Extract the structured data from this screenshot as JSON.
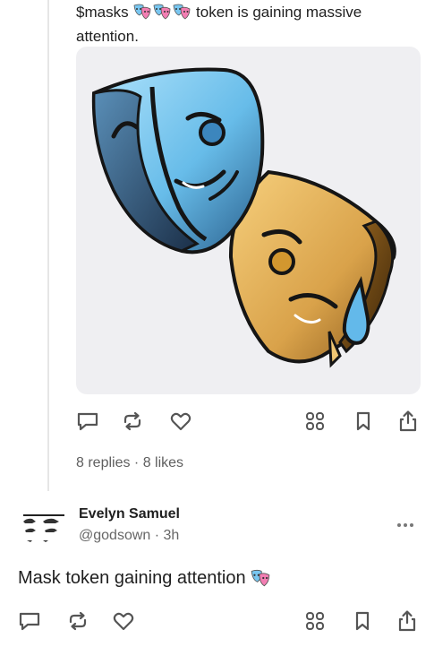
{
  "post": {
    "text_start": "$masks",
    "text_end": " token is gaining massive attention.",
    "emoji": [
      "performing-arts",
      "performing-arts",
      "performing-arts"
    ],
    "image_alt": "comedy and tragedy theater masks"
  },
  "actions": [
    "reply-icon",
    "repost-icon",
    "like-icon",
    "grid-icon",
    "bookmark-icon",
    "share-icon"
  ],
  "stats": {
    "replies": "8 replies",
    "separator": " · ",
    "likes": "8 likes"
  },
  "reply": {
    "author": "Evelyn Samuel",
    "handle": "@godsown",
    "separator": " · ",
    "time": "3h",
    "text": "Mask token gaining attention",
    "emoji": "performing-arts"
  },
  "colors": {
    "text": "#1f1f1f",
    "muted": "#5f5f5f",
    "icon": "#555555",
    "media_bg": "#efeff2",
    "mask_blue": "#7cc6ef",
    "mask_gold": "#e2b15a"
  }
}
